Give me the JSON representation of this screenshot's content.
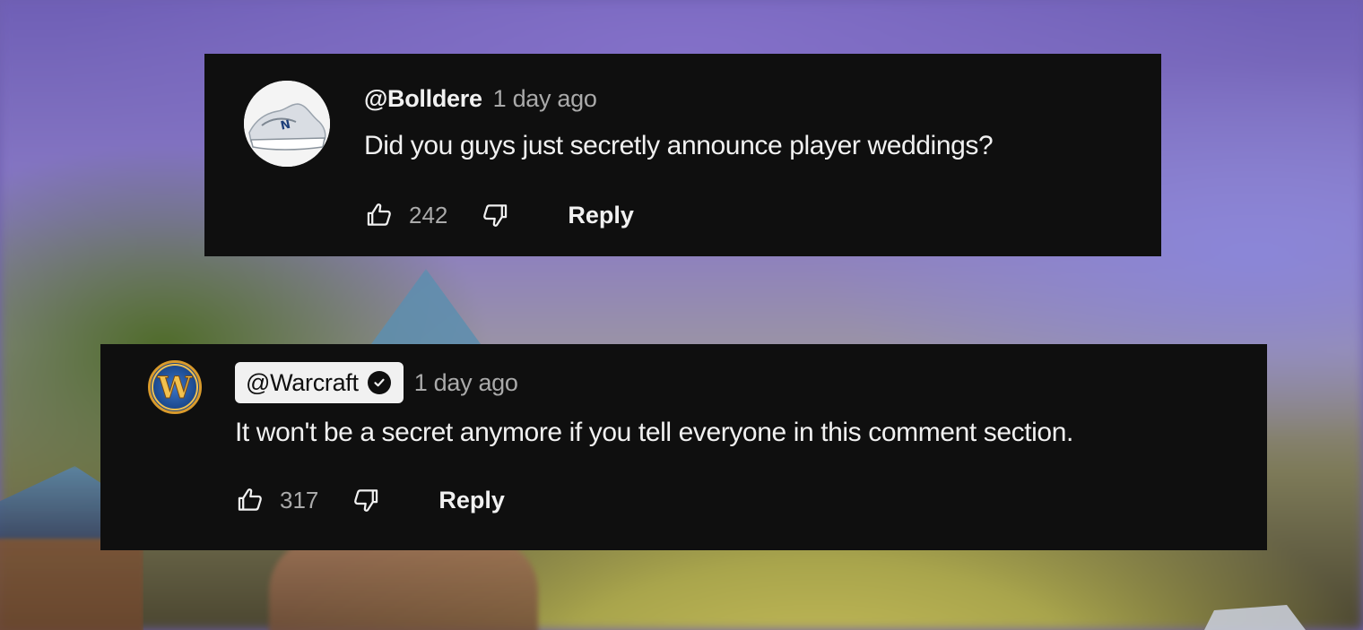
{
  "comments": [
    {
      "author": "@Bolldere",
      "time": "1 day ago",
      "text": "Did you guys just secretly announce player weddings?",
      "likes": "242",
      "reply_label": "Reply",
      "avatar_icon": "sneaker-avatar",
      "is_channel_owner": false
    },
    {
      "author": "@Warcraft",
      "time": "1 day ago",
      "text": "It won't be a secret anymore if you tell everyone in this comment section.",
      "likes": "317",
      "reply_label": "Reply",
      "avatar_icon": "warcraft-logo-avatar",
      "is_channel_owner": true,
      "verified_icon": "verified-check-icon"
    }
  ],
  "colors": {
    "card_bg": "#0f0f0f",
    "text_primary": "#f1f1f1",
    "text_secondary": "#aaaaaa",
    "owner_chip_bg": "#f1f1f1",
    "warcraft_gold": "#d99a2b",
    "warcraft_blue": "#1f4e94"
  }
}
